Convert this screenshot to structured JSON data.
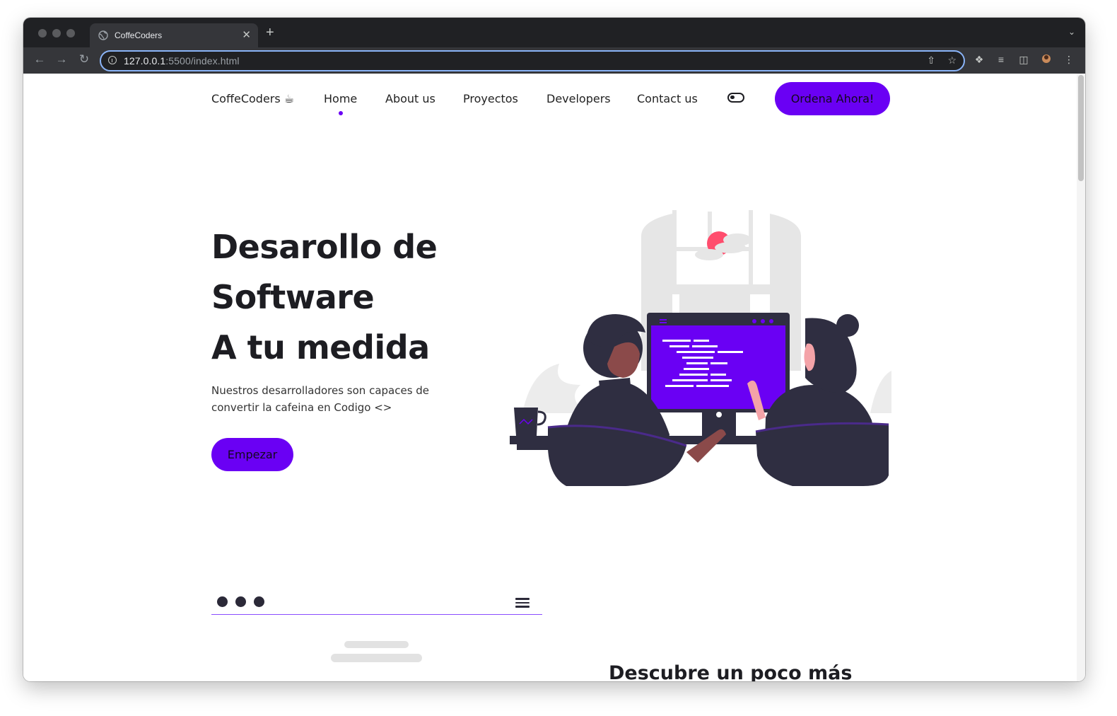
{
  "browser": {
    "tab_title": "CoffeCoders",
    "tab_close": "✕",
    "new_tab": "+",
    "url_host": "127.0.0.1",
    "url_rest": ":5500/index.html"
  },
  "nav": {
    "brand": "CoffeCoders ☕",
    "links": [
      "Home",
      "About us",
      "Proyectos",
      "Developers",
      "Contact us"
    ],
    "active": "Home",
    "cta": "Ordena Ahora!"
  },
  "hero": {
    "title_lines": [
      "Desarollo de",
      "Software",
      "A tu medida"
    ],
    "description": "Nuestros desarrolladores son capaces de convertir la cafeina en Codigo <>",
    "button": "Empezar"
  },
  "section": {
    "title": "Descubre un poco más"
  },
  "colors": {
    "accent": "#6a00f4",
    "dark": "#2f2e41",
    "sun": "#ff4d6d",
    "skin_light": "#f4a3a8",
    "skin_dark": "#8b4a4a"
  }
}
